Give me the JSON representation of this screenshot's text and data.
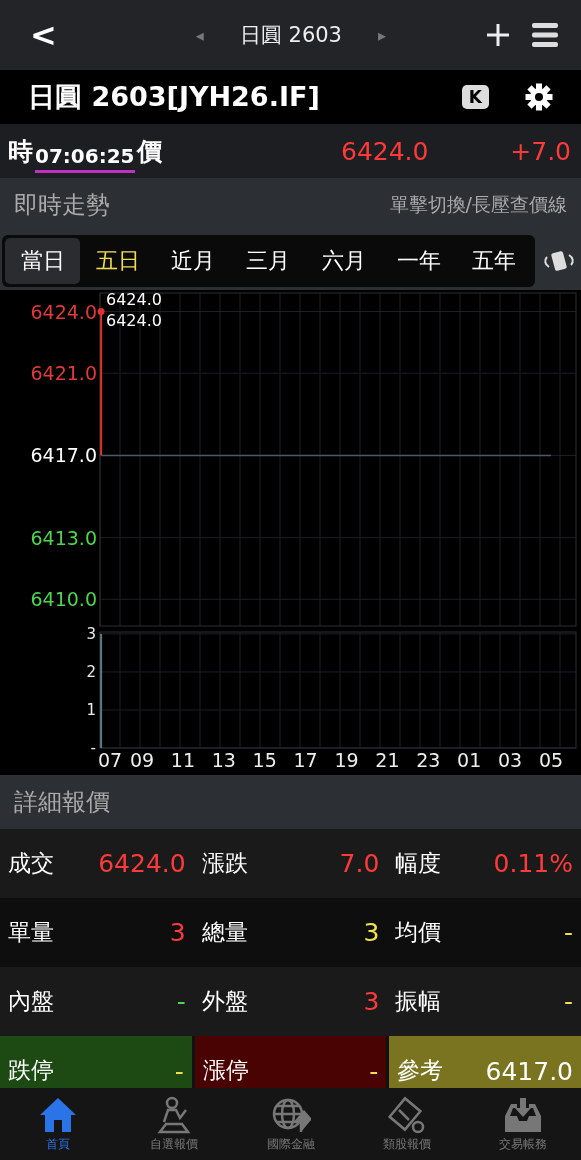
{
  "nav": {
    "back": "<",
    "prev": "◂",
    "title": "日圓 2603",
    "next": "▸"
  },
  "header": {
    "title": "日圓 2603[JYH26.IF]",
    "k_badge": "K"
  },
  "quote": {
    "time_label": "時",
    "time": "07:06:25",
    "price_label": "價",
    "price": "6424.0",
    "change": "+7.0",
    "rising": true
  },
  "trend": {
    "title": "即時走勢",
    "hint": "單擊切換/長壓查價線"
  },
  "ranges": [
    {
      "label": "當日",
      "selected": true,
      "highlight": false
    },
    {
      "label": "五日",
      "selected": false,
      "highlight": true
    },
    {
      "label": "近月",
      "selected": false,
      "highlight": false
    },
    {
      "label": "三月",
      "selected": false,
      "highlight": false
    },
    {
      "label": "六月",
      "selected": false,
      "highlight": false
    },
    {
      "label": "一年",
      "selected": false,
      "highlight": false
    },
    {
      "label": "五年",
      "selected": false,
      "highlight": false
    }
  ],
  "price_chart": {
    "chart_data": {
      "type": "line",
      "grid": true,
      "categories": [
        "07",
        "09",
        "11",
        "13",
        "15",
        "17",
        "19",
        "21",
        "23",
        "01",
        "03",
        "05"
      ],
      "ylim": [
        6408.7,
        6424.9
      ],
      "yticks": [
        {
          "value": 6424,
          "label": "6424.0"
        },
        {
          "value": 6421,
          "label": "6421.0"
        },
        {
          "value": 6417,
          "label": "6417.0"
        },
        {
          "value": 6413,
          "label": "6413.0"
        },
        {
          "value": 6410,
          "label": "6410.0"
        }
      ],
      "series": [
        {
          "color": "#e03030",
          "marker": true,
          "values": [
            6424.0,
            null,
            null,
            null,
            null,
            null,
            null,
            null,
            null,
            null,
            null,
            null
          ]
        },
        {
          "color": "#4a5a6a",
          "values": [
            6417.0,
            6417.0,
            6417.0,
            6417.0,
            6417.0,
            6417.0,
            6417.0,
            6417.0,
            6417.0,
            6417.0,
            6417.0,
            6417.0
          ]
        }
      ],
      "annotations": [
        "6424.0",
        "6424.0"
      ]
    }
  },
  "volume_chart": {
    "chart_data": {
      "type": "bar",
      "grid": true,
      "ylim": [
        0,
        3.05
      ],
      "yticks": [
        {
          "value": 0,
          "label": "-"
        },
        1,
        2,
        3
      ],
      "series": [
        {
          "color": "#5a7a8a",
          "values": [
            3,
            null,
            null,
            null,
            null,
            null,
            null,
            null,
            null,
            null,
            null,
            null
          ]
        }
      ]
    }
  },
  "detail": {
    "title": "詳細報價",
    "rows": [
      [
        {
          "label": "成交",
          "value": "6424.0",
          "color": "#ff3a3a"
        },
        {
          "label": "漲跌",
          "value": "7.0",
          "color": "#ff3a3a"
        },
        {
          "label": "幅度",
          "value": "0.11%",
          "color": "#ff3a3a"
        }
      ],
      [
        {
          "label": "單量",
          "value": "3",
          "color": "#ff3a3a"
        },
        {
          "label": "總量",
          "value": "3",
          "color": "#f2e14a"
        },
        {
          "label": "均價",
          "value": "-",
          "color": "#f2e14a"
        }
      ],
      [
        {
          "label": "內盤",
          "value": "-",
          "color": "#4fd44f"
        },
        {
          "label": "外盤",
          "value": "3",
          "color": "#ff3a3a"
        },
        {
          "label": "振幅",
          "value": "-",
          "color": "#f2e14a"
        }
      ]
    ],
    "limits": [
      {
        "kind": "limit_down",
        "label": "跌停",
        "value": "-",
        "color": "#f2e14a"
      },
      {
        "kind": "limit_up",
        "label": "漲停",
        "value": "-",
        "color": "#f2e14a"
      },
      {
        "kind": "reference",
        "label": "參考",
        "value": "6417.0",
        "color": "#ffffff"
      }
    ]
  },
  "tabbar": [
    {
      "label": "首頁",
      "selected": true
    },
    {
      "label": "自選報價",
      "selected": false
    },
    {
      "label": "國際金融",
      "selected": false
    },
    {
      "label": "類股報價",
      "selected": false
    },
    {
      "label": "交易帳務",
      "selected": false
    }
  ]
}
